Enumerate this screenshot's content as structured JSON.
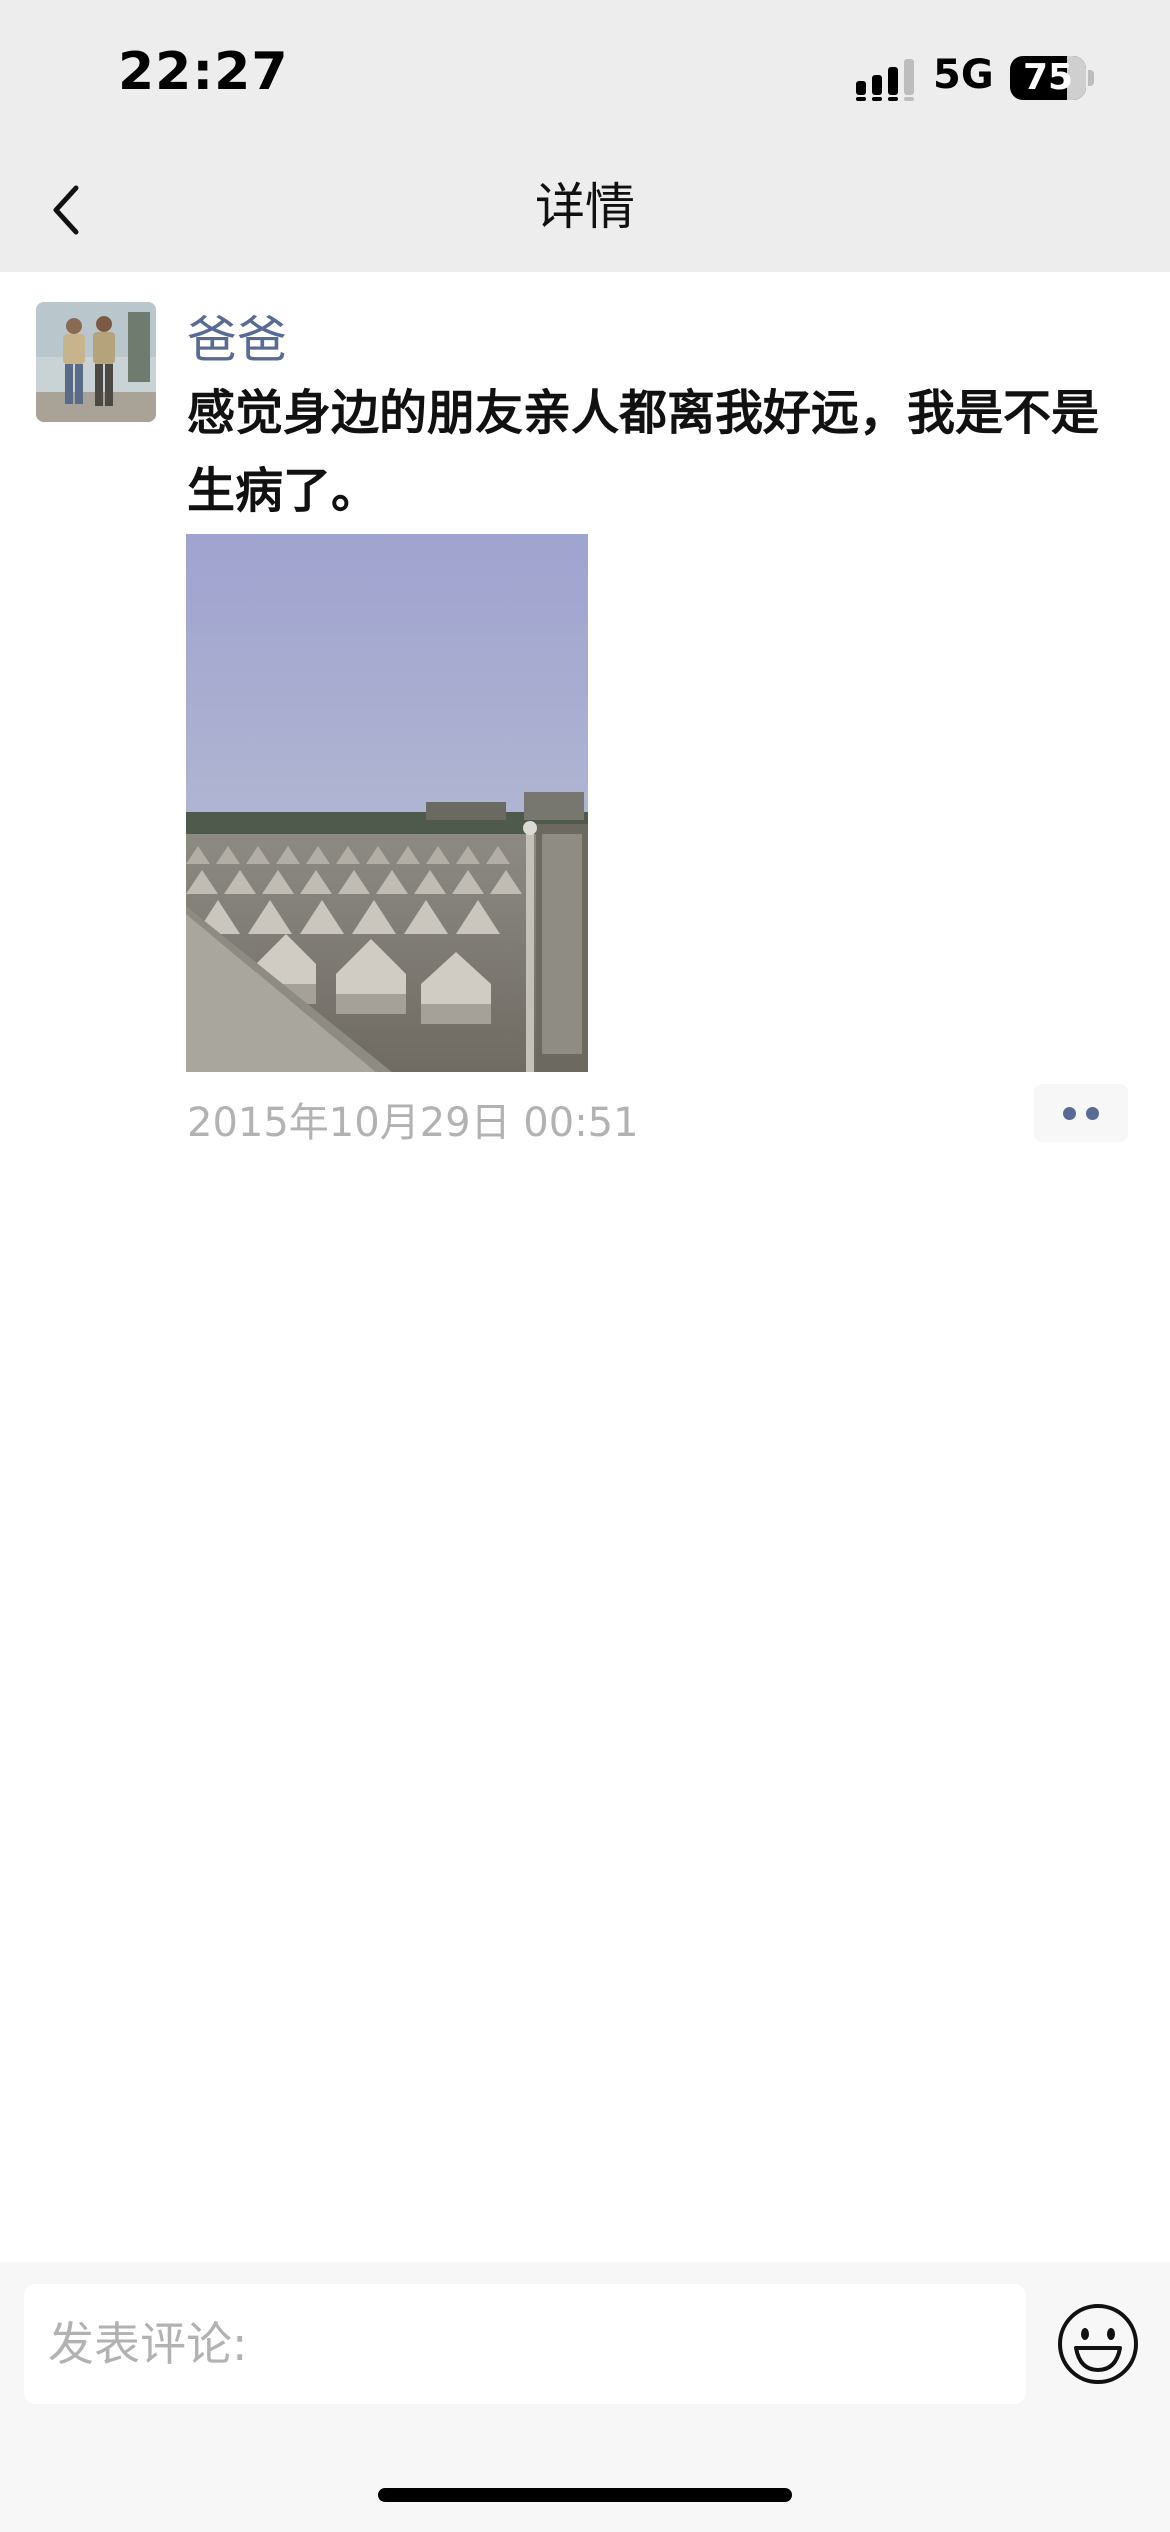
{
  "status_bar": {
    "time": "22:27",
    "network": "5G",
    "battery_level": "75",
    "icons": [
      "signal-icon",
      "battery-icon"
    ]
  },
  "nav": {
    "title": "详情",
    "back_icon": "chevron-left-icon"
  },
  "post": {
    "author": "爸爸",
    "text": "感觉身边的朋友亲人都离我好远，我是不是生病了。",
    "image": "photo of rows of pointed concrete grave mounds under a hazy sky",
    "timestamp": "2015年10月29日 00:51",
    "more_icon": "more-dots-icon"
  },
  "comment_bar": {
    "placeholder": "发表评论:",
    "value": "",
    "emoji_icon": "emoji-icon"
  },
  "colors": {
    "bar_background": "#ededed",
    "author_link": "#576b95",
    "secondary_text": "#b2b2b2",
    "body_text": "#111111",
    "comment_bar_background": "#f7f7f7"
  }
}
